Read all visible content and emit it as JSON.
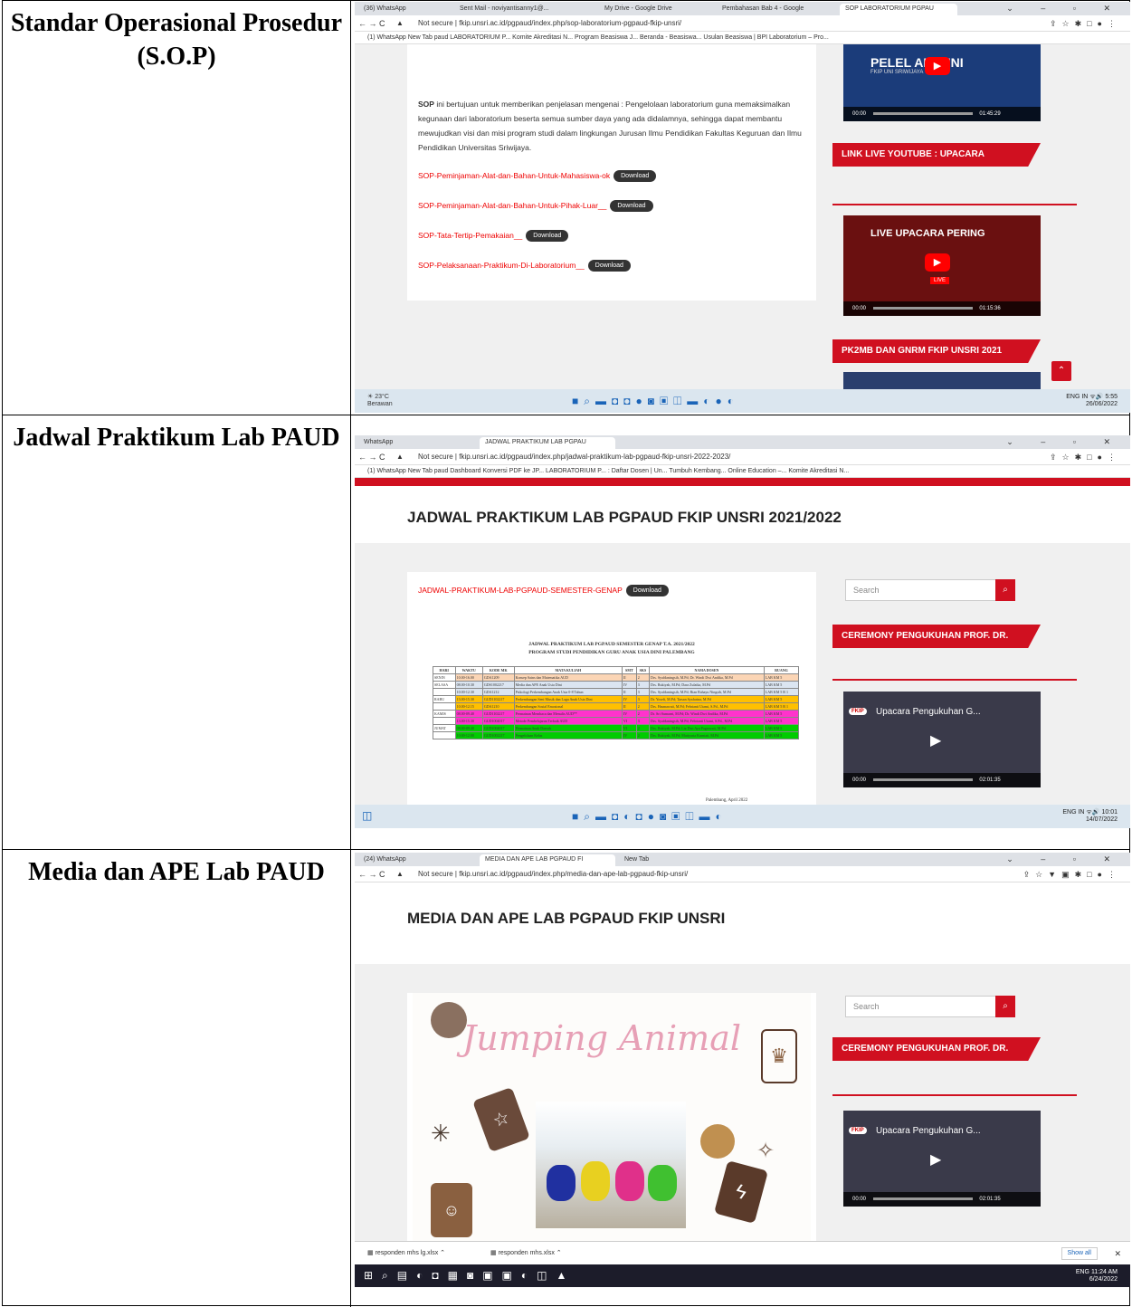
{
  "rows": [
    {
      "label": "Standar Operasional Prosedur (S.O.P)",
      "browser": {
        "tabs": [
          "(36) WhatsApp",
          "Sent Mail - noviyantisanny1@...",
          "My Drive - Google Drive",
          "Pembahasan Bab 4 - Google",
          "SOP LABORATORIUM PGPAU"
        ],
        "security": "Not secure",
        "url": "fkip.unsri.ac.id/pgpaud/index.php/sop-laboratorium-pgpaud-fkip-unsri/",
        "bookmarks": "(1) WhatsApp   New Tab   paud   LABORATORIUM P...   Komite Akreditasi N...   Program Beasiswa J...   Beranda - Beasiswa...   Usulan Beasiswa | BPI   Laboratorium – Pro..."
      },
      "intro_bold": "SOP",
      "intro": "ini bertujuan untuk memberikan penjelasan mengenai : Pengelolaan laboratorium guna memaksimalkan kegunaan dari laboratorium beserta semua sumber daya yang ada didalamnya, sehingga dapat membantu mewujudkan visi dan misi program studi dalam lingkungan Jurusan Ilmu Pendidikan Fakultas Keguruan dan Ilmu Pendidikan Universitas Sriwijaya.",
      "links": [
        "SOP-Peminjaman-Alat-dan-Bahan-Untuk-Mahasiswa-ok",
        "SOP-Peminjaman-Alat-dan-Bahan-Untuk-Pihak-Luar__",
        "SOP-Tata-Tertip-Pemakaian__",
        "SOP-Pelaksanaan-Praktikum-Di-Laboratorium__"
      ],
      "download_label": "Download",
      "video1": {
        "caption": "PELEL  ALUMNI",
        "sub": "FKIP UNI  SRIWIJAYA",
        "time_start": "00:00",
        "time_end": "01:45:29"
      },
      "sidebar_title1": "LINK LIVE YOUTUBE : UPACARA",
      "video2": {
        "caption": "LIVE UPACARA PERING",
        "badge": "LIVE",
        "time_start": "00:00",
        "time_end": "01:15:36"
      },
      "sidebar_title2": "PK2MB DAN GNRM FKIP UNSRI 2021",
      "taskbar": {
        "weather_temp": "23°C",
        "weather_desc": "Berawan",
        "lang": "ENG IN",
        "time": "5:55",
        "date": "26/06/2022"
      }
    },
    {
      "label": "Jadwal Praktikum Lab PAUD",
      "browser": {
        "tabs": [
          "WhatsApp",
          "JADWAL PRAKTIKUM LAB PGPAU"
        ],
        "security": "Not secure",
        "url": "fkip.unsri.ac.id/pgpaud/index.php/jadwal-praktikum-lab-pgpaud-fkip-unsri-2022-2023/",
        "bookmarks": "(1) WhatsApp   New Tab   paud   Dashboard   Konversi PDF ke JP...   LABORATORIUM P...   : Daftar Dosen | Un...   Tumbuh Kembang...   Online Education –...   Komite Akreditasi N..."
      },
      "page_title": "JADWAL PRAKTIKUM LAB PGPAUD FKIP UNSRI 2021/2022",
      "link": "JADWAL-PRAKTIKUM-LAB-PGPAUD-SEMESTER-GENAP",
      "download_label": "Download",
      "schedule_title": "JADWAL PRAKTIKUM LAB PGPAUD SEMESTER GENAP T.A. 2021/2022",
      "schedule_subtitle": "PROGRAM STUDI PENDIDIKAN GURU ANAK USIA DINI PALEMBANG",
      "schedule_headers": [
        "HARI",
        "WAKTU",
        "KODE MK",
        "MATA KULIAH",
        "SMT",
        "SKS",
        "NAMA DOSEN",
        "RUANG"
      ],
      "schedule_rows": [
        {
          "day": "SENIN",
          "time": "10.00-16.00",
          "code": "GDA1209",
          "course": "Konsep Sains dan Matematika AUD",
          "smt": "II",
          "sks": "2",
          "lecturer": "Drs. Syafdaningsih, M.Pd; Dr. Windi Dwi Andika, M.Pd",
          "room": "LAB KM 5",
          "color": "#fbd5b5"
        },
        {
          "day": "SELASA",
          "time": "08.00-10.30",
          "code": "GDS1002217",
          "course": "Media dan APE Anak Usia Dini",
          "smt": "IV",
          "sks": "3",
          "lecturer": "Drs. Rukiyah, M.Pd; Dara Zulaika, M.Pd",
          "room": "LAB KM 5",
          "color": "#dbe5f1"
        },
        {
          "day": "",
          "time": "10.00-12.30",
          "code": "GDA1212",
          "course": "Psikologi Perkembangan Anak Usia 0-8 Tahun",
          "smt": "II",
          "sks": "3",
          "lecturer": "Drs. Syafdaningsih, M.Pd; Rian Rahayu Ningsih, M.Pd",
          "room": "LAB KM 5 R 1",
          "color": "#dbe5f1"
        },
        {
          "day": "RABU",
          "time": "13.00-15.30",
          "code": "GUD1102217",
          "course": "Perkembangan Seni Musik dan Lagu Anak Usia Dini",
          "smt": "IV",
          "sks": "3",
          "lecturer": "Dr. Yosefi, M.Pd; Tarsan Syafarina, M.Pd",
          "room": "LAB KM 5",
          "color": "#ffc000"
        },
        {
          "day": "",
          "time": "10.00-12.15",
          "code": "GDA1210",
          "course": "Perkembangan Sosial Emosional",
          "smt": "II",
          "sks": "2",
          "lecturer": "Drs. Hasmawati, M.Pd; Febrianti Utami, S.Pd., M.Pd",
          "room": "LAB KM 5 R 1",
          "color": "#ffc000"
        },
        {
          "day": "KAMIS",
          "time": "08.00-09.40",
          "code": "GUD1102217",
          "course": "Permainan Membaca dan Menulis AUD**",
          "smt": "IV",
          "sks": "2",
          "lecturer": "Dr. Sri Sumarni, M.Pd; Dr. Windi Dwi Andika, M.Pd",
          "room": "LAB KM 5",
          "color": "#ff33cc"
        },
        {
          "day": "",
          "time": "13.00-15.30",
          "code": "GUD1004017",
          "course": "Metode Pembelajaran Terbaik AUD",
          "smt": "VI",
          "sks": "3",
          "lecturer": "Drs. Syafdaningsih, M.Pd; Febrianti Utami, S.Pd., M.Pd",
          "room": "LAB KM 5",
          "color": "#ff33cc"
        },
        {
          "day": "JUMAT",
          "time": "08.00-09.40",
          "code": "GUD1004017",
          "course": "Permainan Anak Daerah",
          "smt": "VI",
          "sks": "2",
          "lecturer": "Drs. Rukiyah, M.Pd; Liz Dwi Ayu Pagarwati, M.Pd",
          "room": "LAB KM 5",
          "color": "#00cc00"
        },
        {
          "day": "",
          "time": "10.00-12.00",
          "code": "GUD1002217",
          "course": "Pengelolaan Kelas",
          "smt": "IV",
          "sks": "2",
          "lecturer": "Drs. Rukiyah, M.Pd; Mutiyaria Kurniati, M.Pd",
          "room": "LAB KM 5",
          "color": "#00cc00"
        }
      ],
      "schedule_footer": "Palembang, April 2022",
      "search_placeholder": "Search",
      "sidebar_title": "CEREMONY PENGUKUHAN PROF. DR.",
      "video": {
        "caption": "Upacara Pengukuhan G...",
        "badge": "FKIP",
        "time_start": "00:00",
        "time_end": "02:01:35"
      },
      "taskbar": {
        "lang": "ENG IN",
        "time": "10:01",
        "date": "14/07/2022"
      }
    },
    {
      "label": "Media dan APE Lab PAUD",
      "browser": {
        "tabs": [
          "(24) WhatsApp",
          "MEDIA DAN APE LAB PGPAUD FI",
          "New Tab"
        ],
        "security": "Not secure",
        "url": "fkip.unsri.ac.id/pgpaud/index.php/media-dan-ape-lab-pgpaud-fkip-unsri/"
      },
      "page_title": "MEDIA DAN APE LAB PGPAUD FKIP UNSRI",
      "poster_text": "Jumping Animal",
      "search_placeholder": "Search",
      "sidebar_title": "CEREMONY PENGUKUHAN PROF. DR.",
      "video": {
        "caption": "Upacara Pengukuhan G...",
        "badge": "FKIP",
        "time_start": "00:00",
        "time_end": "02:01:35"
      },
      "downloads": [
        "responden mhs lg.xlsx",
        "responden mhs.xlsx"
      ],
      "show_all": "Show all",
      "taskbar": {
        "lang": "ENG",
        "time": "11:24 AM",
        "date": "6/24/2022"
      }
    }
  ],
  "colors": {
    "accent_red": "#d01020",
    "link_red": "#e00000"
  }
}
